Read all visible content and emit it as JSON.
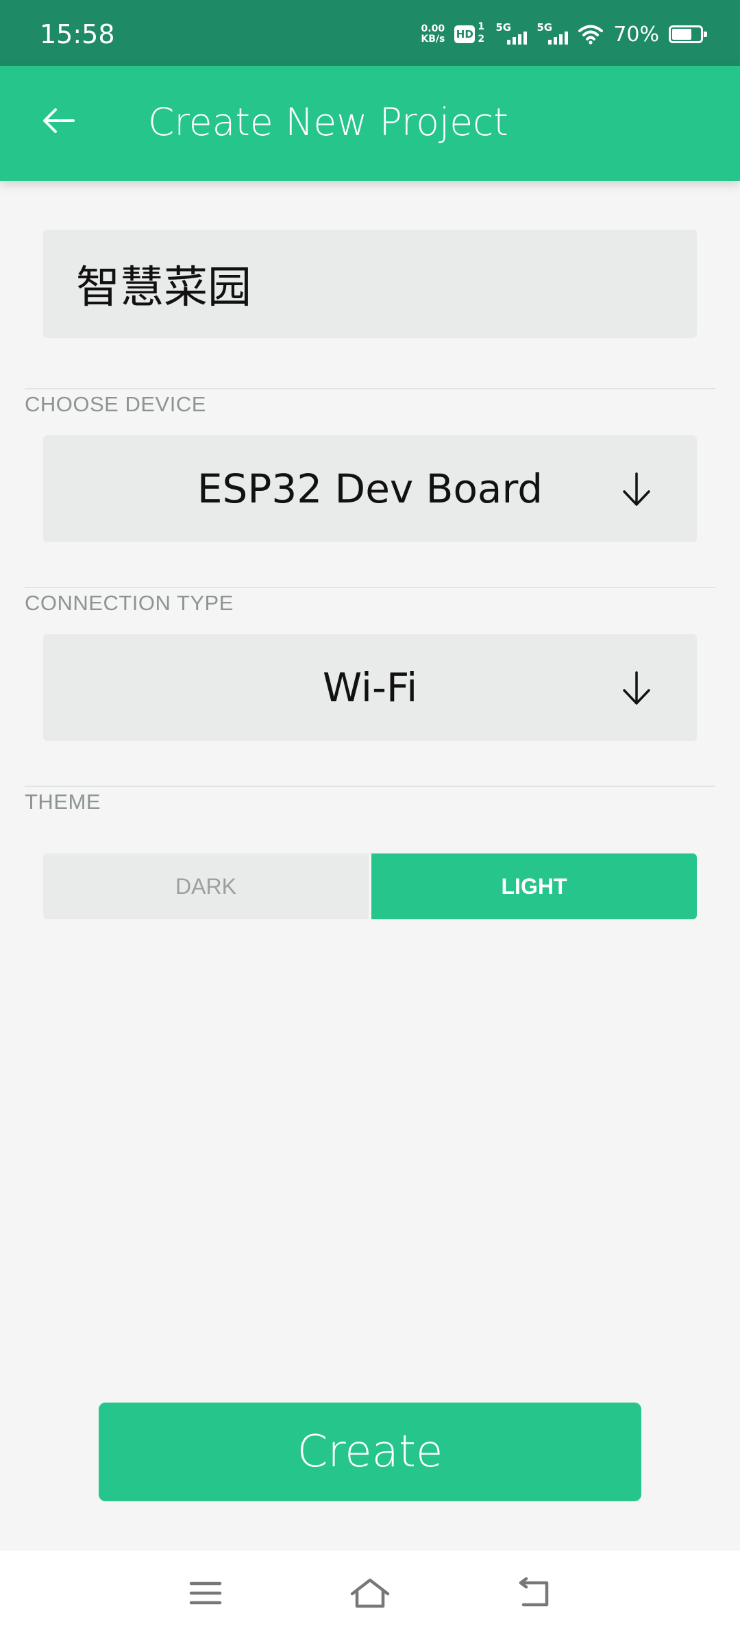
{
  "status_bar": {
    "time": "15:58",
    "net_speed_value": "0.00",
    "net_speed_unit": "KB/s",
    "hd_label": "HD",
    "hd_sup": "1",
    "hd_sub": "2",
    "sim1_label": "5G",
    "sim2_label": "5G",
    "battery_percent": "70%",
    "battery_level": 0.7
  },
  "app_bar": {
    "title": "Create New Project",
    "back_icon": "arrow-left-icon"
  },
  "form": {
    "project_name": "智慧菜园",
    "device_section_label": "CHOOSE DEVICE",
    "device_value": "ESP32 Dev Board",
    "connection_section_label": "CONNECTION TYPE",
    "connection_value": "Wi-Fi",
    "theme_section_label": "THEME",
    "theme_options": [
      "DARK",
      "LIGHT"
    ],
    "theme_selected": "LIGHT"
  },
  "create_button": "Create",
  "colors": {
    "accent": "#26c58c",
    "status_bar": "#1e8a66",
    "field_bg": "#e9eaea",
    "page_bg": "#f5f5f5"
  },
  "nav_bar": {
    "icons": [
      "menu-icon",
      "home-icon",
      "back-icon"
    ]
  }
}
